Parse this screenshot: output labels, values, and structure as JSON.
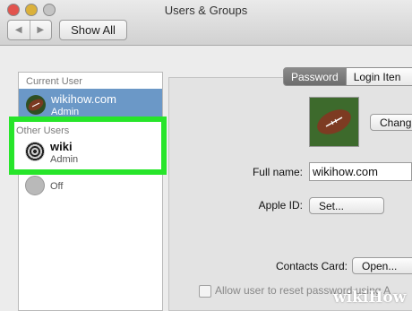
{
  "window": {
    "title": "Users & Groups"
  },
  "toolbar": {
    "back_glyph": "◀",
    "forward_glyph": "▶",
    "show_all_label": "Show All"
  },
  "sidebar": {
    "current_header": "Current User",
    "current_user": {
      "name": "wikihow.com",
      "role": "Admin"
    },
    "other_header": "Other Users",
    "other_user": {
      "name": "wiki",
      "role": "Admin"
    },
    "guest": {
      "status": "Off"
    }
  },
  "tabs": {
    "password": "Password",
    "login_items": "Login Iten"
  },
  "panel": {
    "change_button": "Chang",
    "fullname_label": "Full name:",
    "fullname_value": "wikihow.com",
    "appleid_label": "Apple ID:",
    "set_button": "Set...",
    "contacts_label": "Contacts Card:",
    "open_button": "Open...",
    "reset_checkbox_label": "Allow user to reset password using A"
  },
  "watermark": {
    "wiki": "wiki",
    "how": "How"
  },
  "colors": {
    "highlight": "#27e52a",
    "selection": "#6b98c7"
  }
}
